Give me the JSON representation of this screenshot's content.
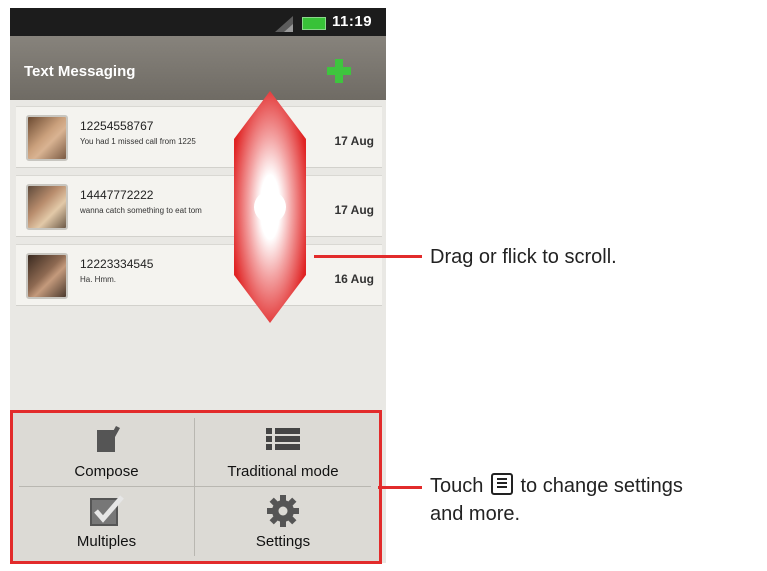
{
  "status_bar": {
    "time": "11:19"
  },
  "header": {
    "title": "Text Messaging",
    "add_icon": "plus-icon"
  },
  "threads": [
    {
      "number": "12254558767",
      "preview": "You had 1 missed call from 1225",
      "date": "17 Aug"
    },
    {
      "number": "14447772222",
      "preview": "wanna catch something to eat tom",
      "date": "17 Aug"
    },
    {
      "number": "12223334545",
      "preview": "Ha. Hmm.",
      "date": "16 Aug"
    }
  ],
  "menu": {
    "items": [
      {
        "label": "Compose",
        "icon": "compose-icon"
      },
      {
        "label": "Traditional mode",
        "icon": "list-icon"
      },
      {
        "label": "Multiples",
        "icon": "checkbox-icon"
      },
      {
        "label": "Settings",
        "icon": "gear-icon"
      }
    ]
  },
  "callouts": {
    "scroll": "Drag or flick to scroll.",
    "menu_before": "Touch",
    "menu_after": "to change settings",
    "menu_line2": "and more."
  },
  "colors": {
    "accent": "#e22b2b",
    "header": "#7b776f",
    "add": "#3ec53e"
  }
}
